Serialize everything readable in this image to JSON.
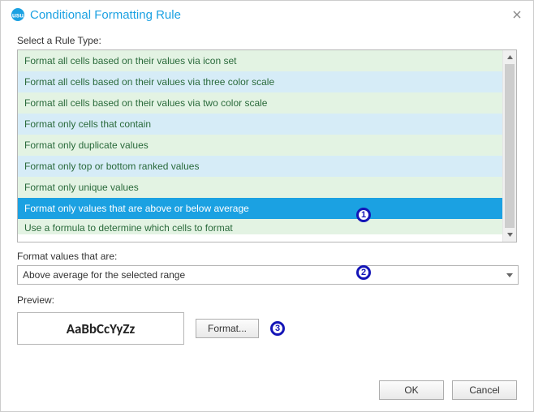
{
  "dialog": {
    "title": "Conditional Formatting Rule",
    "close_icon": "×"
  },
  "labels": {
    "rule_type": "Select a Rule Type:",
    "format_values": "Format values that are:",
    "preview": "Preview:"
  },
  "rule_types": [
    "Format all cells based on their values via icon set",
    "Format all cells based on their values via three color scale",
    "Format all cells based on their values via two color scale",
    "Format only cells that contain",
    "Format only duplicate values",
    "Format only top or bottom ranked values",
    "Format only unique values",
    "Format only values that are above or below average",
    "Use a formula to determine which cells to format"
  ],
  "selected_rule_index": 7,
  "combo": {
    "value": "Above average for the selected range"
  },
  "preview": {
    "sample_text": "AaBbCcYyZz"
  },
  "buttons": {
    "format": "Format...",
    "ok": "OK",
    "cancel": "Cancel"
  },
  "callouts": {
    "one": "1",
    "two": "2",
    "three": "3"
  }
}
